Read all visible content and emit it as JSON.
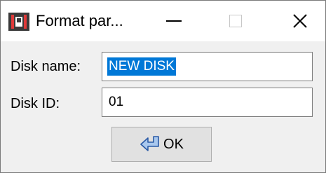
{
  "window": {
    "title": "Format par...",
    "controls": {
      "minimize": "minimize-icon",
      "maximize": "maximize-icon",
      "close": "close-icon"
    }
  },
  "form": {
    "disk_name_label": "Disk name:",
    "disk_name_value": "NEW DISK",
    "disk_id_label": "Disk ID:",
    "disk_id_value": "01"
  },
  "buttons": {
    "ok_label": "OK"
  },
  "colors": {
    "selection": "#0078d7",
    "window_bg": "#f0f0f0",
    "titlebar_bg": "#ffffff"
  }
}
